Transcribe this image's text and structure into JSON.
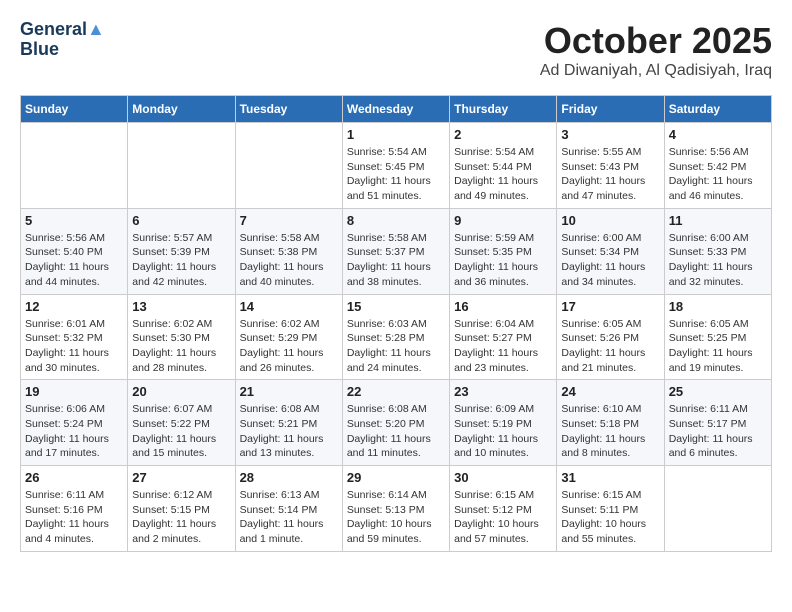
{
  "logo": {
    "line1": "General",
    "line2": "Blue"
  },
  "title": "October 2025",
  "location": "Ad Diwaniyah, Al Qadisiyah, Iraq",
  "weekdays": [
    "Sunday",
    "Monday",
    "Tuesday",
    "Wednesday",
    "Thursday",
    "Friday",
    "Saturday"
  ],
  "weeks": [
    [
      {
        "day": "",
        "info": ""
      },
      {
        "day": "",
        "info": ""
      },
      {
        "day": "",
        "info": ""
      },
      {
        "day": "1",
        "info": "Sunrise: 5:54 AM\nSunset: 5:45 PM\nDaylight: 11 hours\nand 51 minutes."
      },
      {
        "day": "2",
        "info": "Sunrise: 5:54 AM\nSunset: 5:44 PM\nDaylight: 11 hours\nand 49 minutes."
      },
      {
        "day": "3",
        "info": "Sunrise: 5:55 AM\nSunset: 5:43 PM\nDaylight: 11 hours\nand 47 minutes."
      },
      {
        "day": "4",
        "info": "Sunrise: 5:56 AM\nSunset: 5:42 PM\nDaylight: 11 hours\nand 46 minutes."
      }
    ],
    [
      {
        "day": "5",
        "info": "Sunrise: 5:56 AM\nSunset: 5:40 PM\nDaylight: 11 hours\nand 44 minutes."
      },
      {
        "day": "6",
        "info": "Sunrise: 5:57 AM\nSunset: 5:39 PM\nDaylight: 11 hours\nand 42 minutes."
      },
      {
        "day": "7",
        "info": "Sunrise: 5:58 AM\nSunset: 5:38 PM\nDaylight: 11 hours\nand 40 minutes."
      },
      {
        "day": "8",
        "info": "Sunrise: 5:58 AM\nSunset: 5:37 PM\nDaylight: 11 hours\nand 38 minutes."
      },
      {
        "day": "9",
        "info": "Sunrise: 5:59 AM\nSunset: 5:35 PM\nDaylight: 11 hours\nand 36 minutes."
      },
      {
        "day": "10",
        "info": "Sunrise: 6:00 AM\nSunset: 5:34 PM\nDaylight: 11 hours\nand 34 minutes."
      },
      {
        "day": "11",
        "info": "Sunrise: 6:00 AM\nSunset: 5:33 PM\nDaylight: 11 hours\nand 32 minutes."
      }
    ],
    [
      {
        "day": "12",
        "info": "Sunrise: 6:01 AM\nSunset: 5:32 PM\nDaylight: 11 hours\nand 30 minutes."
      },
      {
        "day": "13",
        "info": "Sunrise: 6:02 AM\nSunset: 5:30 PM\nDaylight: 11 hours\nand 28 minutes."
      },
      {
        "day": "14",
        "info": "Sunrise: 6:02 AM\nSunset: 5:29 PM\nDaylight: 11 hours\nand 26 minutes."
      },
      {
        "day": "15",
        "info": "Sunrise: 6:03 AM\nSunset: 5:28 PM\nDaylight: 11 hours\nand 24 minutes."
      },
      {
        "day": "16",
        "info": "Sunrise: 6:04 AM\nSunset: 5:27 PM\nDaylight: 11 hours\nand 23 minutes."
      },
      {
        "day": "17",
        "info": "Sunrise: 6:05 AM\nSunset: 5:26 PM\nDaylight: 11 hours\nand 21 minutes."
      },
      {
        "day": "18",
        "info": "Sunrise: 6:05 AM\nSunset: 5:25 PM\nDaylight: 11 hours\nand 19 minutes."
      }
    ],
    [
      {
        "day": "19",
        "info": "Sunrise: 6:06 AM\nSunset: 5:24 PM\nDaylight: 11 hours\nand 17 minutes."
      },
      {
        "day": "20",
        "info": "Sunrise: 6:07 AM\nSunset: 5:22 PM\nDaylight: 11 hours\nand 15 minutes."
      },
      {
        "day": "21",
        "info": "Sunrise: 6:08 AM\nSunset: 5:21 PM\nDaylight: 11 hours\nand 13 minutes."
      },
      {
        "day": "22",
        "info": "Sunrise: 6:08 AM\nSunset: 5:20 PM\nDaylight: 11 hours\nand 11 minutes."
      },
      {
        "day": "23",
        "info": "Sunrise: 6:09 AM\nSunset: 5:19 PM\nDaylight: 11 hours\nand 10 minutes."
      },
      {
        "day": "24",
        "info": "Sunrise: 6:10 AM\nSunset: 5:18 PM\nDaylight: 11 hours\nand 8 minutes."
      },
      {
        "day": "25",
        "info": "Sunrise: 6:11 AM\nSunset: 5:17 PM\nDaylight: 11 hours\nand 6 minutes."
      }
    ],
    [
      {
        "day": "26",
        "info": "Sunrise: 6:11 AM\nSunset: 5:16 PM\nDaylight: 11 hours\nand 4 minutes."
      },
      {
        "day": "27",
        "info": "Sunrise: 6:12 AM\nSunset: 5:15 PM\nDaylight: 11 hours\nand 2 minutes."
      },
      {
        "day": "28",
        "info": "Sunrise: 6:13 AM\nSunset: 5:14 PM\nDaylight: 11 hours\nand 1 minute."
      },
      {
        "day": "29",
        "info": "Sunrise: 6:14 AM\nSunset: 5:13 PM\nDaylight: 10 hours\nand 59 minutes."
      },
      {
        "day": "30",
        "info": "Sunrise: 6:15 AM\nSunset: 5:12 PM\nDaylight: 10 hours\nand 57 minutes."
      },
      {
        "day": "31",
        "info": "Sunrise: 6:15 AM\nSunset: 5:11 PM\nDaylight: 10 hours\nand 55 minutes."
      },
      {
        "day": "",
        "info": ""
      }
    ]
  ]
}
